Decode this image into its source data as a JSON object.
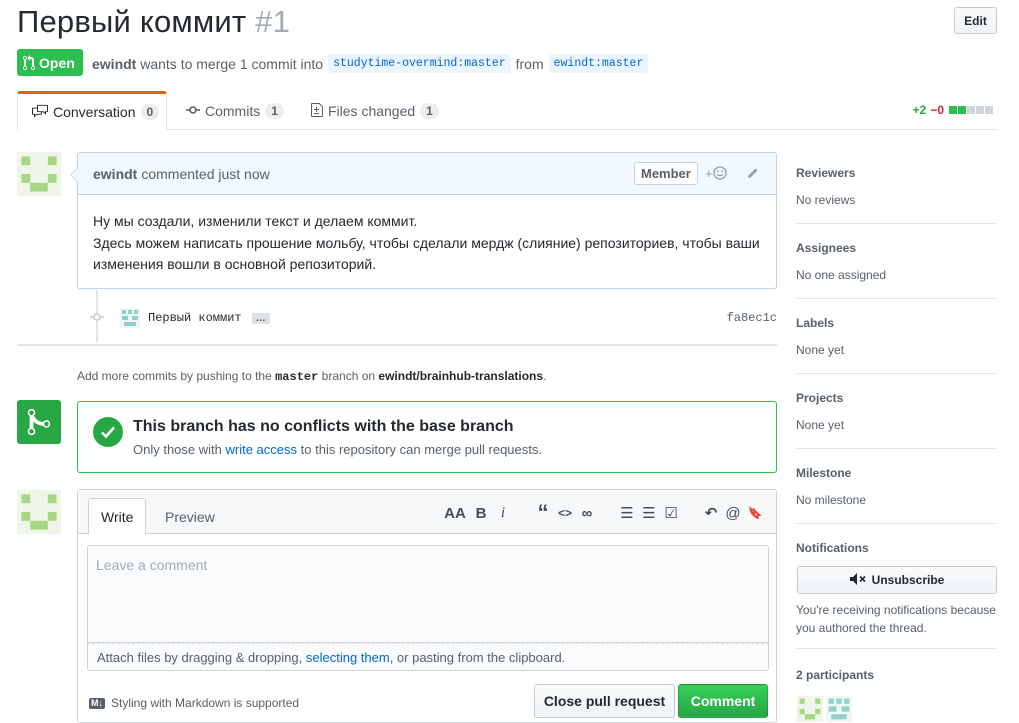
{
  "header": {
    "title": "Первый коммит",
    "number": "#1",
    "edit_label": "Edit",
    "state_label": "Open",
    "author": "ewindt",
    "merge_text": "wants to merge 1 commit into",
    "base_branch": "studytime-overmind:master",
    "from_text": "from",
    "head_branch": "ewindt:master"
  },
  "tabs": [
    {
      "label": "Conversation",
      "count": "0"
    },
    {
      "label": "Commits",
      "count": "1"
    },
    {
      "label": "Files changed",
      "count": "1"
    }
  ],
  "diffstat": {
    "additions": "+2",
    "deletions": "−0"
  },
  "comment": {
    "author": "ewindt",
    "action": "commented just now",
    "badge": "Member",
    "lines": [
      "Ну мы создали, изменили текст и делаем коммит.",
      "Здесь можем написать прошение мольбу, чтобы сделали мердж (слияние) репозиториев, чтобы ваши изменения вошли в основной репозиторий."
    ]
  },
  "commit": {
    "message": "Первый коммит",
    "ellipsis": "…",
    "sha": "fa8ec1c"
  },
  "push_hint": {
    "prefix": "Add more commits by pushing to the",
    "branch": "master",
    "middle": "branch on",
    "repo": "ewindt/brainhub-translations",
    "suffix": "."
  },
  "merge": {
    "title": "This branch has no conflicts with the base branch",
    "sub_prefix": "Only those with",
    "sub_link": "write access",
    "sub_suffix": "to this repository can merge pull requests."
  },
  "composer": {
    "write_tab": "Write",
    "preview_tab": "Preview",
    "placeholder": "Leave a comment",
    "attach_prefix": "Attach files by dragging & dropping,",
    "attach_link": "selecting them",
    "attach_suffix": ", or pasting from the clipboard.",
    "markdown_note": "Styling with Markdown is supported",
    "markdown_badge": "M↓",
    "close_label": "Close pull request",
    "comment_label": "Comment",
    "toolbar": {
      "header": "AA",
      "bold": "B",
      "italic": "i",
      "quote": "“",
      "code": "<>",
      "link": "∞",
      "ul": "☰",
      "ol": "☰",
      "task": "☑",
      "reply": "↶",
      "mention": "@",
      "saved": "🔖"
    }
  },
  "sidebar": {
    "reviewers": {
      "title": "Reviewers",
      "value": "No reviews"
    },
    "assignees": {
      "title": "Assignees",
      "value": "No one assigned"
    },
    "labels": {
      "title": "Labels",
      "value": "None yet"
    },
    "projects": {
      "title": "Projects",
      "value": "None yet"
    },
    "milestone": {
      "title": "Milestone",
      "value": "No milestone"
    },
    "notifications": {
      "title": "Notifications",
      "button": "Unsubscribe",
      "text": "You're receiving notifications because you authored the thread."
    },
    "participants": {
      "title": "2 participants"
    }
  },
  "colors": {
    "accent_open": "#2cbe4e",
    "link": "#0366d6",
    "tab_active": "#e36209",
    "avatar_green": "#a6d785",
    "avatar_teal": "#8fd1c8"
  }
}
